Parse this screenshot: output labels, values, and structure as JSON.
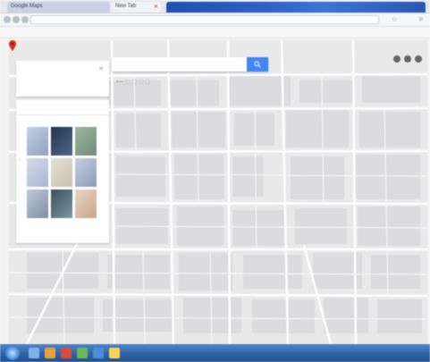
{
  "browser": {
    "tabs": [
      {
        "label": "Google Maps"
      },
      {
        "label": "New Tab"
      },
      {
        "label": ""
      }
    ],
    "address": ""
  },
  "bookmarks": [
    "",
    "",
    "",
    "",
    "",
    "",
    ""
  ],
  "search": {
    "value": "",
    "placeholder": ""
  },
  "panel": {
    "title": "",
    "link": "",
    "photos_header": "",
    "photos_footer": ""
  },
  "map": {
    "labels": [
      "",
      "",
      "",
      "",
      ""
    ]
  },
  "taskbar": {
    "clock": ""
  },
  "colors": {
    "search_button": "#4285f4",
    "pin": "#d93025",
    "taskbar": "#2f63a8"
  }
}
